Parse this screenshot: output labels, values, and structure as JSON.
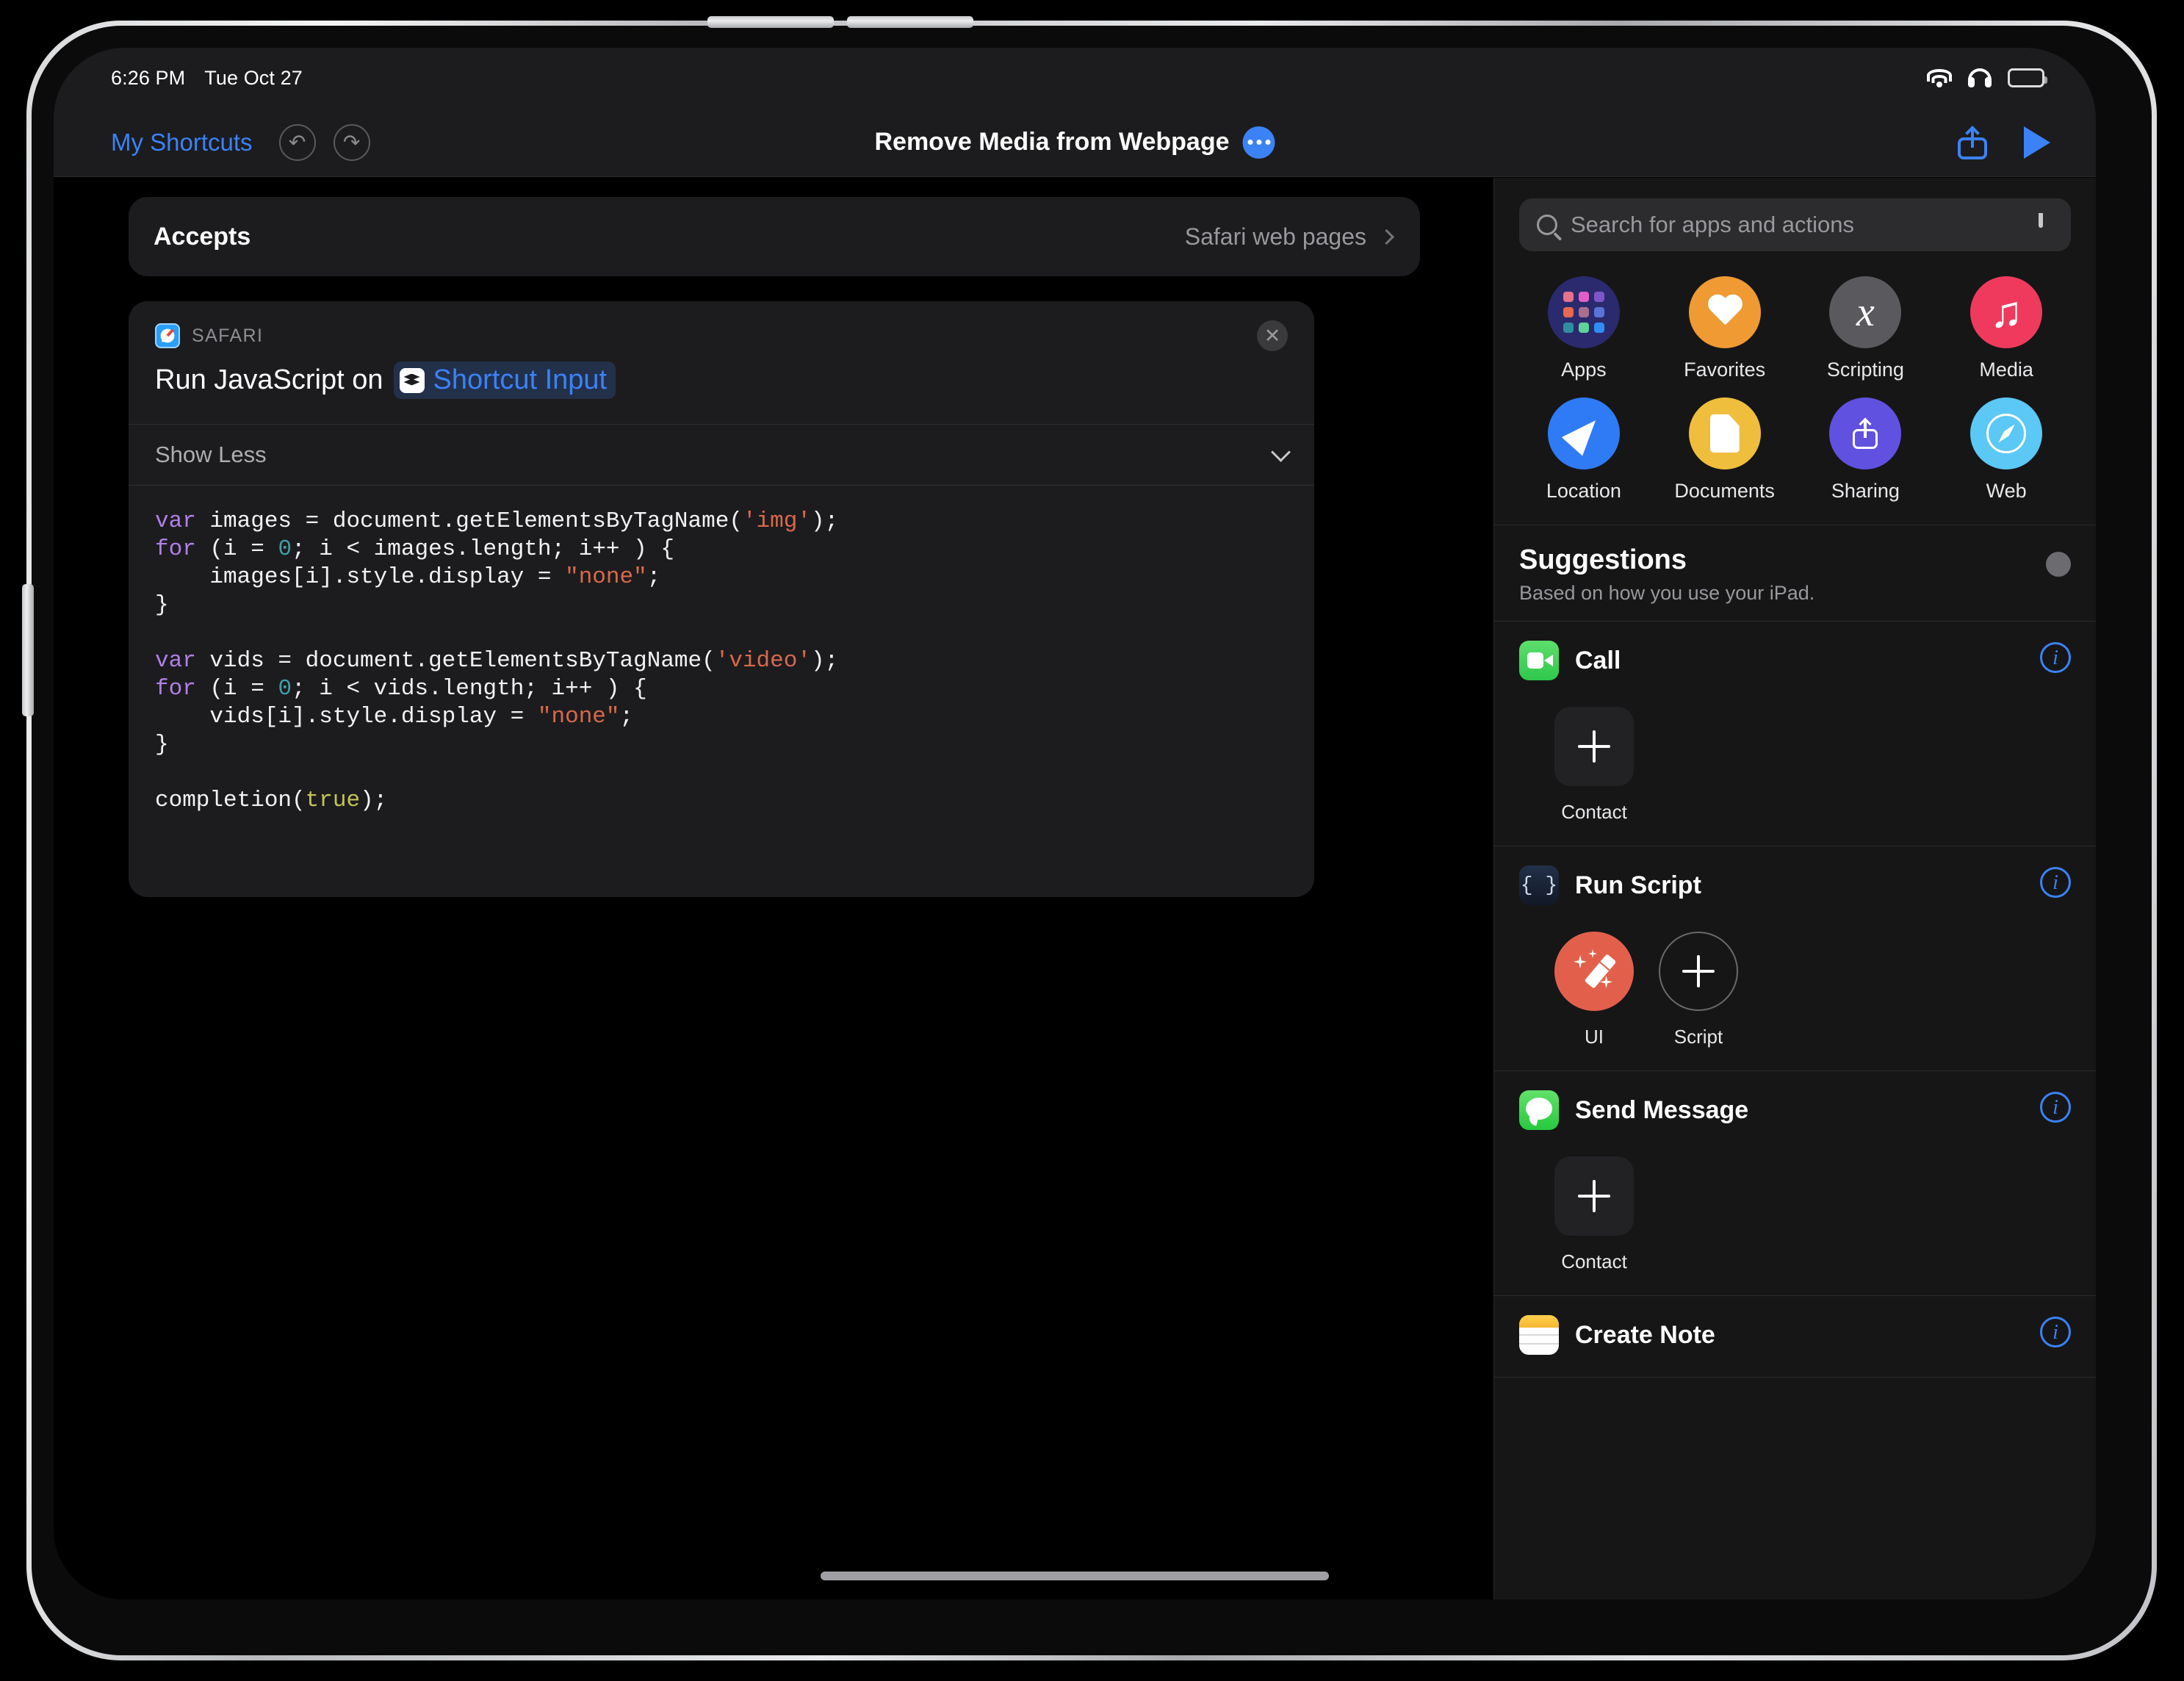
{
  "status_bar": {
    "time": "6:26 PM",
    "date": "Tue Oct 27",
    "wifi_icon": "wifi-icon",
    "headphones_icon": "headphones-icon",
    "battery_icon": "battery-icon"
  },
  "nav_bar": {
    "back_label": "My Shortcuts",
    "undo_icon": "undo-icon",
    "undo_glyph": "↶",
    "redo_icon": "redo-icon",
    "redo_glyph": "↷",
    "title": "Remove Media from Webpage",
    "options_icon": "ellipsis-icon",
    "share_icon": "share-icon",
    "run_icon": "play-icon"
  },
  "editor": {
    "accepts": {
      "label": "Accepts",
      "value": "Safari web pages",
      "chevron_icon": "chevron-right-icon"
    },
    "action": {
      "app_name": "SAFARI",
      "app_icon": "safari-icon",
      "delete_icon": "close-circle-icon",
      "delete_glyph": "✕",
      "title": "Run JavaScript on",
      "input_token": "Shortcut Input",
      "token_icon": "shortcut-input-icon",
      "disclosure_label": "Show Less",
      "disclosure_icon": "chevron-down-icon",
      "code_lines": [
        [
          {
            "t": "var ",
            "c": "kw"
          },
          {
            "t": "images = document.getElementsByTagName("
          },
          {
            "t": "'img'",
            "c": "str"
          },
          {
            "t": ");"
          }
        ],
        [
          {
            "t": "for ",
            "c": "kw"
          },
          {
            "t": "(i = "
          },
          {
            "t": "0",
            "c": "num"
          },
          {
            "t": "; i < images.length; i++ ) {"
          }
        ],
        [
          {
            "t": "    images[i].style.display = "
          },
          {
            "t": "\"none\"",
            "c": "str"
          },
          {
            "t": ";"
          }
        ],
        [
          {
            "t": "}"
          }
        ],
        [
          {
            "t": ""
          }
        ],
        [
          {
            "t": "var ",
            "c": "kw"
          },
          {
            "t": "vids = document.getElementsByTagName("
          },
          {
            "t": "'video'",
            "c": "str"
          },
          {
            "t": ");"
          }
        ],
        [
          {
            "t": "for ",
            "c": "kw"
          },
          {
            "t": "(i = "
          },
          {
            "t": "0",
            "c": "num"
          },
          {
            "t": "; i < vids.length; i++ ) {"
          }
        ],
        [
          {
            "t": "    vids[i].style.display = "
          },
          {
            "t": "\"none\"",
            "c": "str"
          },
          {
            "t": ";"
          }
        ],
        [
          {
            "t": "}"
          }
        ],
        [
          {
            "t": ""
          }
        ],
        [
          {
            "t": "completion("
          },
          {
            "t": "true",
            "c": "bool"
          },
          {
            "t": ");"
          }
        ]
      ]
    }
  },
  "library": {
    "search": {
      "placeholder": "Search for apps and actions",
      "value": "",
      "search_icon": "search-icon",
      "mic_icon": "microphone-icon"
    },
    "categories": [
      {
        "label": "Apps",
        "icon": "apps-grid-icon",
        "color": "#2b2a6e"
      },
      {
        "label": "Favorites",
        "icon": "heart-icon",
        "color": "#ef9a33"
      },
      {
        "label": "Scripting",
        "icon": "variable-x-icon",
        "color": "#5a5a5e"
      },
      {
        "label": "Media",
        "icon": "music-note-icon",
        "color": "#ef3a5d"
      },
      {
        "label": "Location",
        "icon": "navigation-arrow-icon",
        "color": "#2f7bf6"
      },
      {
        "label": "Documents",
        "icon": "document-icon",
        "color": "#efbe3d"
      },
      {
        "label": "Sharing",
        "icon": "share-icon",
        "color": "#6051e0"
      },
      {
        "label": "Web",
        "icon": "compass-icon",
        "color": "#5bc8f5"
      }
    ],
    "apps_dot_colors": [
      "#e8718c",
      "#e35ec8",
      "#7f56c9",
      "#e8694f",
      "#a86f8e",
      "#5874d8",
      "#2f8f9e",
      "#5ed49a",
      "#2f8df6"
    ],
    "suggestions": {
      "title": "Suggestions",
      "subtitle": "Based on how you use your iPad.",
      "toggle_icon": "spinner-icon",
      "info_icon": "info-icon",
      "info_glyph": "i",
      "plus_icon": "plus-icon",
      "items": [
        {
          "name": "Call",
          "app_icon": "facetime-icon",
          "params": [
            {
              "label": "Contact",
              "tile": "plus"
            }
          ]
        },
        {
          "name": "Run Script",
          "app_icon": "run-script-icon",
          "app_glyph": "{ }",
          "params": [
            {
              "label": "UI",
              "tile": "ui"
            },
            {
              "label": "Script",
              "tile": "plus-circle"
            }
          ]
        },
        {
          "name": "Send Message",
          "app_icon": "messages-icon",
          "params": [
            {
              "label": "Contact",
              "tile": "plus"
            }
          ]
        },
        {
          "name": "Create Note",
          "app_icon": "notes-icon",
          "params": []
        }
      ]
    }
  },
  "home_indicator_icon": "home-indicator"
}
